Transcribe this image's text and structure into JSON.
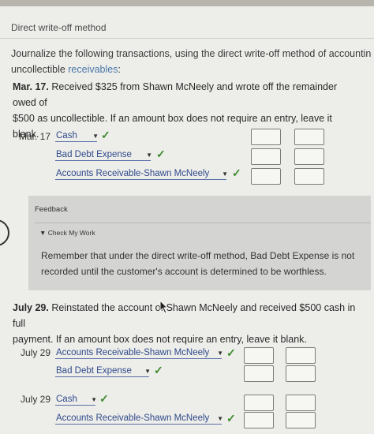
{
  "header": {
    "title": "Direct write-off method"
  },
  "instructions": {
    "line1": "Journalize the following transactions, using the direct write-off method of accounting fo",
    "line2_prefix": "uncollectible ",
    "line2_link": "receivables",
    "line2_suffix": ":"
  },
  "q1": {
    "label": "Mar. 17.",
    "text": " Received $325 from Shawn McNeely and wrote off the remainder owed of",
    "text2": "$500 as uncollectible. If an amount box does not require an entry, leave it blank.",
    "date": "Mar. 17",
    "rows": [
      {
        "account": "Cash"
      },
      {
        "account": "Bad Debt Expense"
      },
      {
        "account": "Accounts Receivable-Shawn McNeely"
      }
    ]
  },
  "feedback": {
    "title": "Feedback",
    "check_label": "Check My Work",
    "text": "Remember that under the direct write-off method, Bad Debt Expense is not recorded until the customer's account is determined to be worthless."
  },
  "q2": {
    "label": "July 29.",
    "text": " Reinstated the account of Shawn McNeely and received $500 cash in full",
    "text2": "payment. If an amount box does not require an entry, leave it blank.",
    "entry1_date": "July 29",
    "entry1_rows": [
      {
        "account": "Accounts Receivable-Shawn McNeely"
      },
      {
        "account": "Bad Debt Expense"
      }
    ],
    "entry2_date": "July 29",
    "entry2_rows": [
      {
        "account": "Cash"
      },
      {
        "account": "Accounts Receivable-Shawn McNeely"
      }
    ]
  },
  "colors": {
    "link": "#4a78a8",
    "check": "#3c8a2c",
    "feedback_bg": "#d4d5d3"
  }
}
